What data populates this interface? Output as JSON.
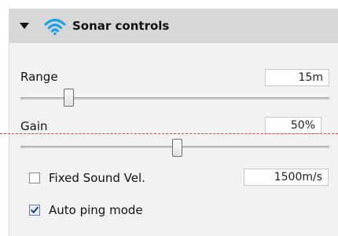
{
  "panel": {
    "title": "Sonar controls",
    "collapse_icon": "triangle-down-icon",
    "header_icon": "wifi-signal-icon",
    "accent_color": "#1aa0e8"
  },
  "range": {
    "label": "Range",
    "value": "15m",
    "slider_fraction": 0.15
  },
  "gain": {
    "label": "Gain",
    "value": "50%",
    "slider_fraction": 0.5
  },
  "sound_velocity": {
    "label": "Fixed Sound Vel.",
    "checked": false,
    "value": "1500m/s"
  },
  "auto_ping": {
    "label": "Auto ping mode",
    "checked": true
  },
  "overlay": {
    "guide_line_color": "#e0453c"
  }
}
